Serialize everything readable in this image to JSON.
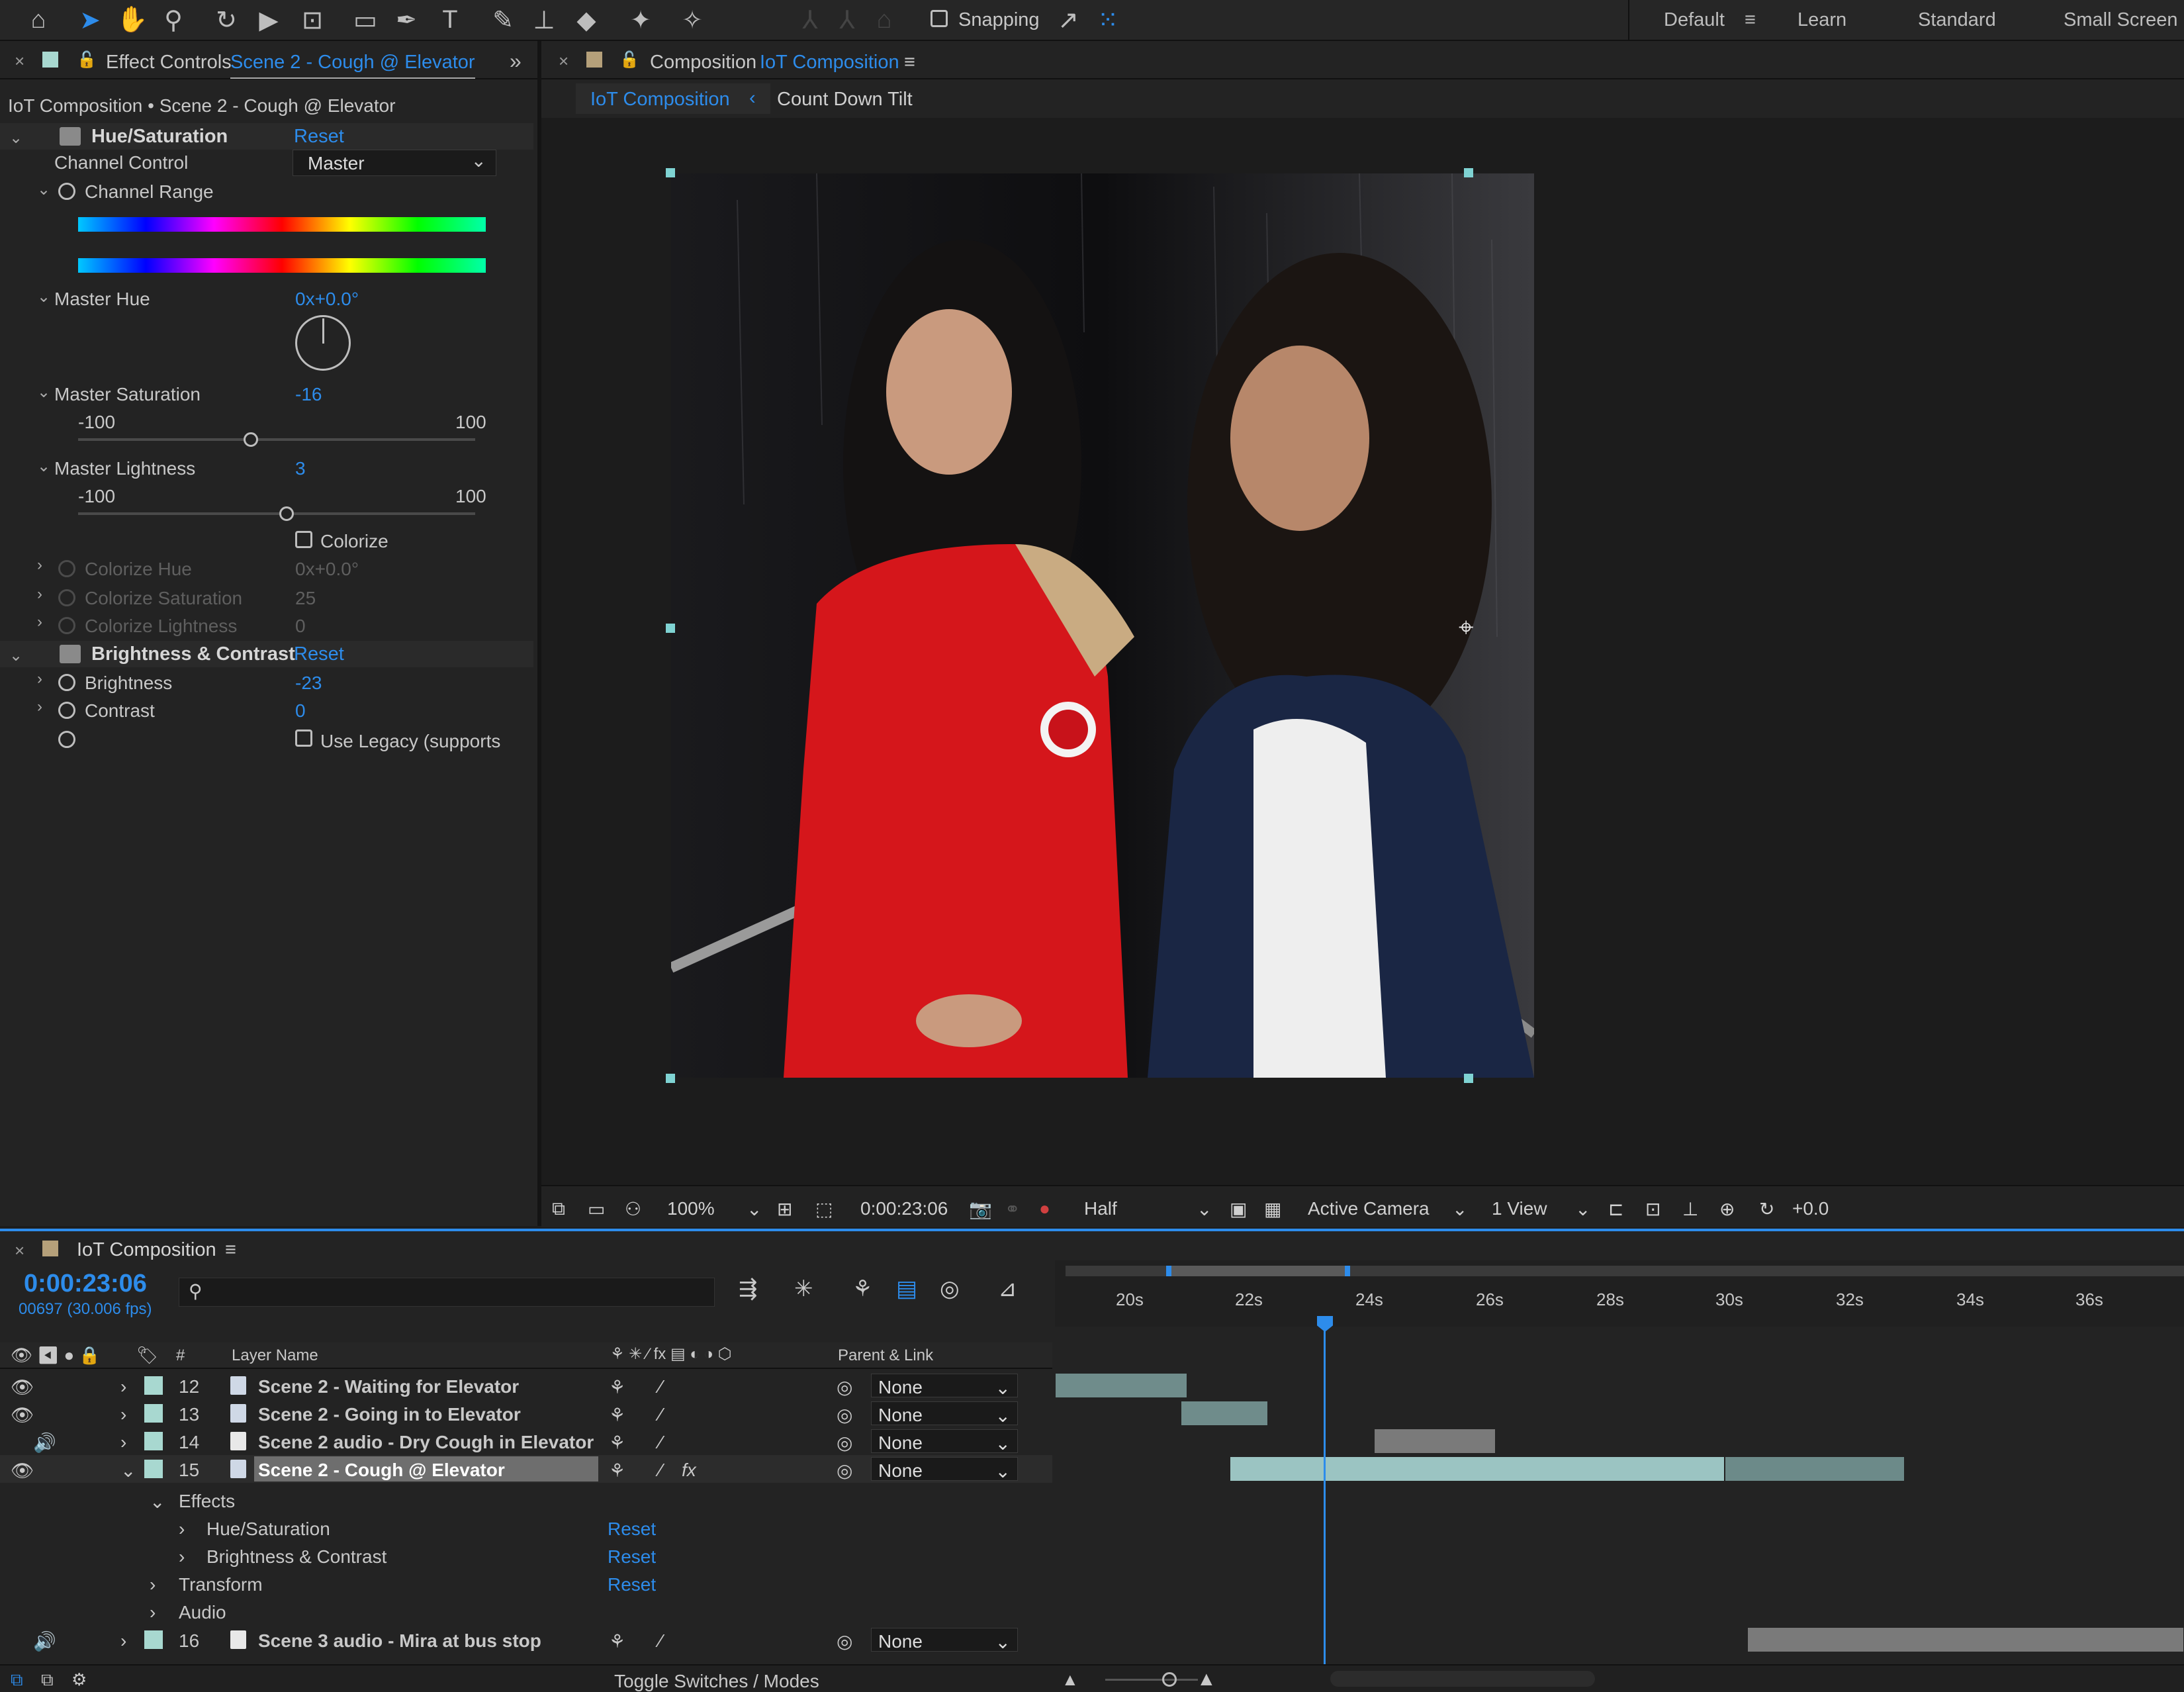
{
  "toolbar": {
    "snapping_label": "Snapping",
    "workspaces": [
      "Default",
      "Learn",
      "Standard",
      "Small Screen"
    ],
    "active_workspace": "Default"
  },
  "effect_controls": {
    "tab_title": "Effect Controls",
    "tab_layer": "Scene 2 - Cough @ Elevator",
    "breadcrumb": "IoT Composition • Scene 2 - Cough @ Elevator",
    "hue_saturation": {
      "name": "Hue/Saturation",
      "reset": "Reset",
      "channel_control_label": "Channel Control",
      "channel_control_value": "Master",
      "channel_range_label": "Channel Range",
      "master_hue_label": "Master Hue",
      "master_hue_value": "0x+0.0°",
      "master_saturation_label": "Master Saturation",
      "master_saturation_value": "-16",
      "saturation_min": "-100",
      "saturation_max": "100",
      "master_lightness_label": "Master Lightness",
      "master_lightness_value": "3",
      "lightness_min": "-100",
      "lightness_max": "100",
      "colorize_label": "Colorize",
      "colorize_hue_label": "Colorize Hue",
      "colorize_hue_value": "0x+0.0°",
      "colorize_saturation_label": "Colorize Saturation",
      "colorize_saturation_value": "25",
      "colorize_lightness_label": "Colorize Lightness",
      "colorize_lightness_value": "0"
    },
    "brightness_contrast": {
      "name": "Brightness & Contrast",
      "reset": "Reset",
      "brightness_label": "Brightness",
      "brightness_value": "-23",
      "contrast_label": "Contrast",
      "contrast_value": "0",
      "legacy_label": "Use Legacy (supports"
    }
  },
  "composition": {
    "tab_title": "Composition",
    "tab_comp": "IoT Composition",
    "breadcrumb_current": "IoT Composition",
    "breadcrumb_next": "Count Down Tilt",
    "viewer": {
      "zoom": "100%",
      "timecode": "0:00:23:06",
      "resolution": "Half",
      "camera": "Active Camera",
      "views": "1 View",
      "exposure": "+0.0"
    }
  },
  "timeline": {
    "tab_title": "IoT Composition",
    "timecode": "0:00:23:06",
    "frame_info": "00697 (30.006 fps)",
    "search_placeholder": "",
    "col_number": "#",
    "col_layer_name": "Layer Name",
    "col_parent": "Parent & Link",
    "ruler_labels": [
      "20s",
      "22s",
      "24s",
      "26s",
      "28s",
      "30s",
      "32s",
      "34s",
      "36s"
    ],
    "layers": [
      {
        "num": "12",
        "name": "Scene 2 - Waiting for Elevator",
        "parent": "None"
      },
      {
        "num": "13",
        "name": "Scene 2 - Going in to Elevator",
        "parent": "None"
      },
      {
        "num": "14",
        "name": "Scene 2 audio - Dry Cough in Elevator",
        "parent": "None"
      },
      {
        "num": "15",
        "name": "Scene 2 - Cough @ Elevator",
        "parent": "None"
      },
      {
        "num": "16",
        "name": "Scene 3 audio - Mira at bus stop",
        "parent": "None"
      }
    ],
    "effects_label": "Effects",
    "sub_hue": "Hue/Saturation",
    "sub_bc": "Brightness & Contrast",
    "transform_label": "Transform",
    "audio_label": "Audio",
    "reset": "Reset",
    "toggle_label": "Toggle Switches / Modes"
  }
}
